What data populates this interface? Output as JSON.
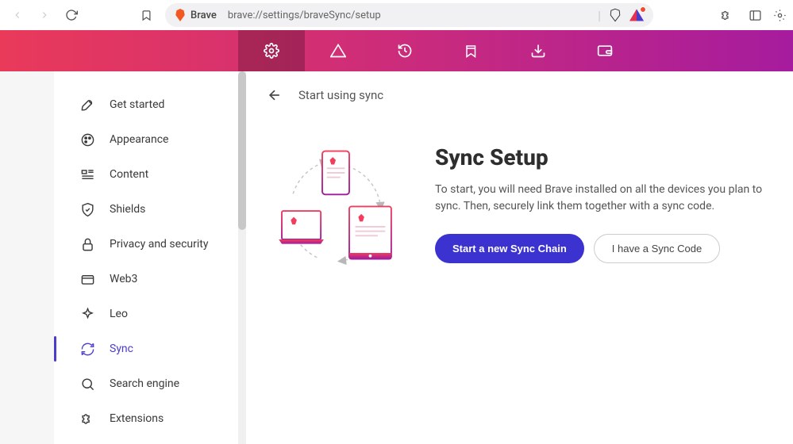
{
  "chrome": {
    "brand": "Brave",
    "url": "brave://settings/braveSync/setup"
  },
  "sidebar": [
    {
      "label": "Get started",
      "icon": "rocket"
    },
    {
      "label": "Appearance",
      "icon": "palette"
    },
    {
      "label": "Content",
      "icon": "content"
    },
    {
      "label": "Shields",
      "icon": "shield"
    },
    {
      "label": "Privacy and security",
      "icon": "lock"
    },
    {
      "label": "Web3",
      "icon": "wallet-card"
    },
    {
      "label": "Leo",
      "icon": "sparkle"
    },
    {
      "label": "Sync",
      "icon": "sync",
      "active": true
    },
    {
      "label": "Search engine",
      "icon": "search"
    },
    {
      "label": "Extensions",
      "icon": "puzzle"
    }
  ],
  "header": {
    "title": "Start using sync"
  },
  "main": {
    "title": "Sync Setup",
    "description": "To start, you will need Brave installed on all the devices you plan to sync. Then, securely link them together with a sync code.",
    "primary_button": "Start a new Sync Chain",
    "secondary_button": "I have a Sync Code"
  }
}
